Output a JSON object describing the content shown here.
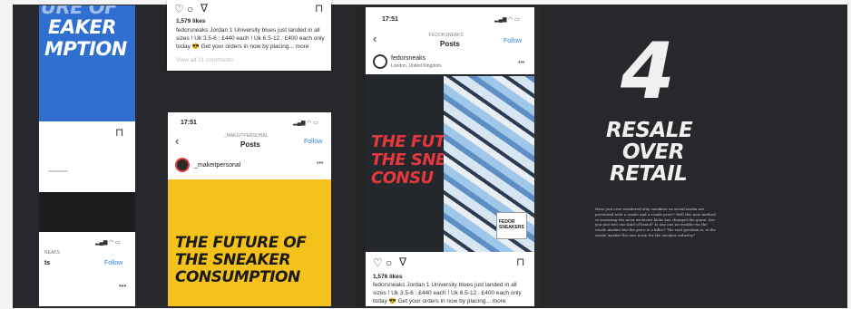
{
  "left_phone": {
    "poster_lines": [
      "URE OF",
      "EAKER",
      "MPTION"
    ],
    "status_fragment": "ts",
    "follow_label": "Follow",
    "username_fragment": "NEAKS"
  },
  "top_post": {
    "likes": "1,579 likes",
    "caption": "fedorsneaks Jordan 1 University blues just landed in all sizes ! Uk 3.5-6 : £440 each ! Uk 6.5-12 : £400 each only today 😎 Get your orders in now by placing... more",
    "faded": "View all 21 comments"
  },
  "yellow_phone": {
    "time": "17:51",
    "account_small": "_MAKEITPERSONAL",
    "title": "Posts",
    "follow_label": "Follow",
    "username": "_makeitpersonal",
    "poster_lines": [
      "THE FUTURE OF",
      "THE SNEAKER",
      "CONSUMPTION"
    ]
  },
  "right_phone": {
    "time": "17:51",
    "account_small": "FEDORSNEAKS",
    "title": "Posts",
    "follow_label": "Follow",
    "username": "fedorsneaks",
    "location": "London, United Kingdom",
    "poster_lines": [
      "THE FUT",
      "THE SNE",
      "CONSU"
    ],
    "likes": "1,576 likes",
    "caption": "fedorsneaks Jordan 1 University blues just landed in all sizes ! Uk 3.5-6 : £440 each ! Uk 6.5-12 : £400 each only today 😎 Get your orders in now by placing... more",
    "box_text": "FEDOR SNEAKERS"
  },
  "chapter": {
    "number": "4",
    "title_lines": [
      "RESALE",
      "OVER",
      "RETAIL"
    ],
    "body": "Have you ever wondered why sneakers on social media are presented with a resale and a resale price? Well this new method of assessing the most exclusive kicks has changed the game. Are you just into one kind of brand? Is any one accessible via the resale market but the price is a killer? The real question is, is the resale market the new norm for the sneaker industry?"
  },
  "colors": {
    "dark_page": "#26282b",
    "yellow": "#f4c21b",
    "blue_poster": "#2f6fd0",
    "red_text": "#e5383d",
    "link_blue": "#2f7fd8"
  }
}
